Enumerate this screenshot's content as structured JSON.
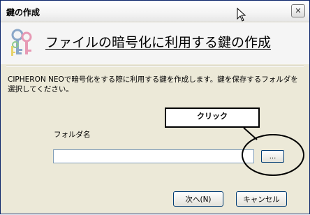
{
  "window": {
    "title": "鍵の作成",
    "close_label": "✕"
  },
  "header": {
    "title": "ファイルの暗号化に利用する鍵の作成"
  },
  "description": "CIPHERON NEOで暗号化をする際に利用する鍵を作成します。鍵を保存するフォルダを選択してください。",
  "callout": {
    "label": "クリック"
  },
  "folder": {
    "label": "フォルダ名",
    "value": "",
    "browse_label": "..."
  },
  "buttons": {
    "next_label": "次へ(N)",
    "cancel_label": "キャンセル"
  },
  "colors": {
    "dialog_bg": "#ece9d8",
    "header_bg": "#f5f5f5",
    "title_border": "#0a246a",
    "input_border": "#7f9db9",
    "button_border": "#003c74",
    "key_blue": "#8aa7c8",
    "key_pink": "#e79ab5",
    "key_green": "#8cc98c",
    "key_yellow": "#e7d36a"
  }
}
